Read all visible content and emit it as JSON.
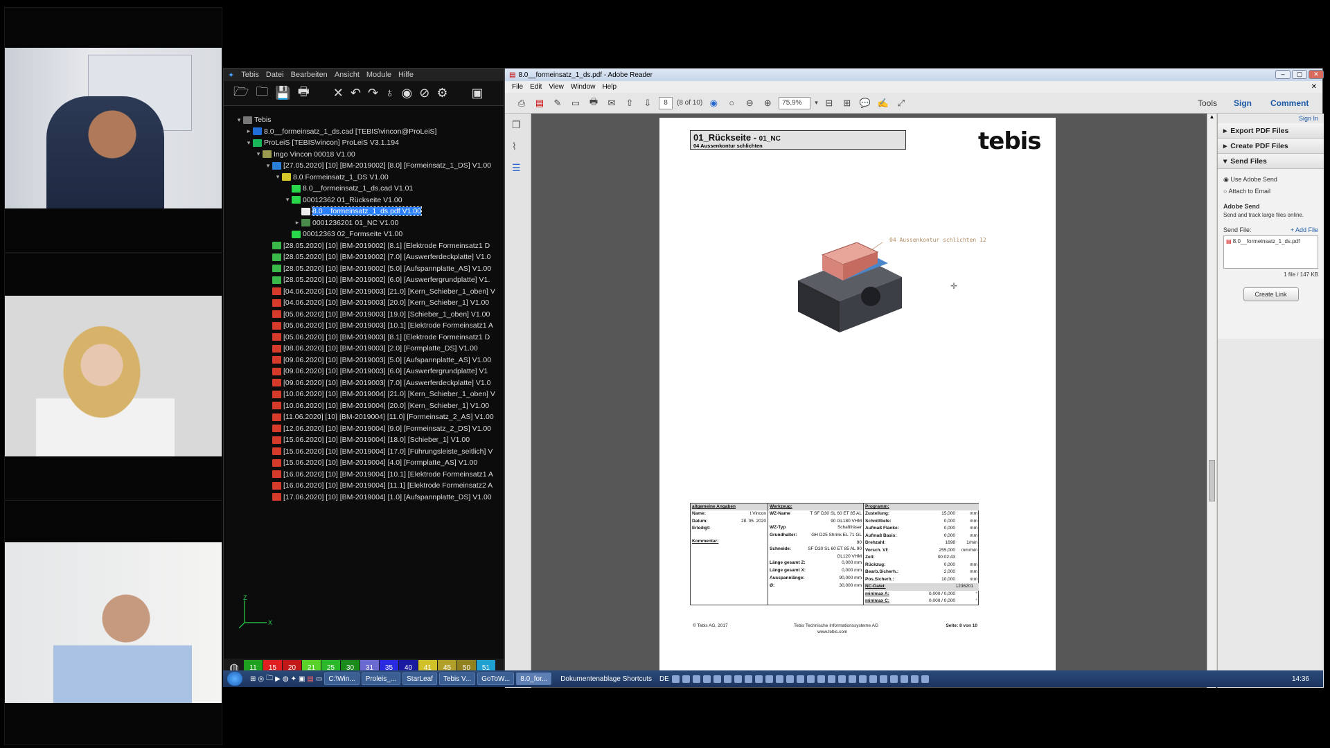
{
  "tebis": {
    "menu": [
      "Tebis",
      "Datei",
      "Bearbeiten",
      "Ansicht",
      "Module",
      "Hilfe"
    ],
    "tree": [
      {
        "label": "Tebis",
        "indent": 0,
        "twisty": "▾",
        "color": "#777"
      },
      {
        "label": "8.0__formeinsatz_1_ds.cad [TEBIS\\vincon@ProLeiS]",
        "indent": 1,
        "twisty": "▸",
        "color": "#1f6fd6"
      },
      {
        "label": "ProLeiS [TEBIS\\vincon] ProLeiS V3.1.194",
        "indent": 1,
        "twisty": "▾",
        "color": "#18b85a"
      },
      {
        "label": "Ingo Vincon 00018 V1.00",
        "indent": 2,
        "twisty": "▾",
        "color": "#9a9a50"
      },
      {
        "label": "[27.05.2020] [10] [BM-2019002] [8.0] [Formeinsatz_1_DS] V1.00",
        "indent": 3,
        "twisty": "▾",
        "color": "#2a7fd6"
      },
      {
        "label": "8.0 Formeinsatz_1_DS V1.00",
        "indent": 4,
        "twisty": "▾",
        "color": "#d6c82a"
      },
      {
        "label": "8.0__formeinsatz_1_ds.cad V1.01",
        "indent": 5,
        "twisty": "",
        "color": "#2ad64a"
      },
      {
        "label": "00012362 01_Rückseite V1.00",
        "indent": 5,
        "twisty": "▾",
        "color": "#2ad64a"
      },
      {
        "label": "8.0__formeinsatz_1_ds.pdf V1.00",
        "indent": 6,
        "twisty": "",
        "color": "#eeeeee",
        "selected": true
      },
      {
        "label": "0001236201 01_NC V1.00",
        "indent": 6,
        "twisty": "▸",
        "color": "#4a8a4a"
      },
      {
        "label": "00012363 02_Formseite V1.00",
        "indent": 5,
        "twisty": "",
        "color": "#2ad64a"
      },
      {
        "label": "[28.05.2020] [10] [BM-2019002] [8.1] [Elektrode Formeinsatz1 D",
        "indent": 3,
        "twisty": "",
        "color": "#3ab84a"
      },
      {
        "label": "[28.05.2020] [10] [BM-2019002] [7.0] [Auswerferdeckplatte] V1.0",
        "indent": 3,
        "twisty": "",
        "color": "#3ab84a"
      },
      {
        "label": "[28.05.2020] [10] [BM-2019002] [5.0] [Aufspannplatte_AS] V1.00",
        "indent": 3,
        "twisty": "",
        "color": "#3ab84a"
      },
      {
        "label": "[28.05.2020] [10] [BM-2019002] [6.0] [Auswerfergrundplatte] V1.",
        "indent": 3,
        "twisty": "",
        "color": "#3ab84a"
      },
      {
        "label": "[04.06.2020] [10] [BM-2019003] [21.0] [Kern_Schieber_1_oben] V",
        "indent": 3,
        "twisty": "",
        "color": "#d63a2a"
      },
      {
        "label": "[04.06.2020] [10] [BM-2019003] [20.0] [Kern_Schieber_1] V1.00",
        "indent": 3,
        "twisty": "",
        "color": "#d63a2a"
      },
      {
        "label": "[05.06.2020] [10] [BM-2019003] [19.0] [Schieber_1_oben] V1.00",
        "indent": 3,
        "twisty": "",
        "color": "#d63a2a"
      },
      {
        "label": "[05.06.2020] [10] [BM-2019003] [10.1] [Elektrode Formeinsatz1 A",
        "indent": 3,
        "twisty": "",
        "color": "#d63a2a"
      },
      {
        "label": "[05.06.2020] [10] [BM-2019003] [8.1] [Elektrode Formeinsatz1 D",
        "indent": 3,
        "twisty": "",
        "color": "#d63a2a"
      },
      {
        "label": "[08.06.2020] [10] [BM-2019003] [2.0] [Formplatte_DS] V1.00",
        "indent": 3,
        "twisty": "",
        "color": "#d63a2a"
      },
      {
        "label": "[09.06.2020] [10] [BM-2019003] [5.0] [Aufspannplatte_AS] V1.00",
        "indent": 3,
        "twisty": "",
        "color": "#d63a2a"
      },
      {
        "label": "[09.06.2020] [10] [BM-2019003] [6.0] [Auswerfergrundplatte] V1",
        "indent": 3,
        "twisty": "",
        "color": "#d63a2a"
      },
      {
        "label": "[09.06.2020] [10] [BM-2019003] [7.0] [Auswerferdeckplatte] V1.0",
        "indent": 3,
        "twisty": "",
        "color": "#d63a2a"
      },
      {
        "label": "[10.06.2020] [10] [BM-2019004] [21.0] [Kern_Schieber_1_oben] V",
        "indent": 3,
        "twisty": "",
        "color": "#d63a2a"
      },
      {
        "label": "[10.06.2020] [10] [BM-2019004] [20.0] [Kern_Schieber_1] V1.00",
        "indent": 3,
        "twisty": "",
        "color": "#d63a2a"
      },
      {
        "label": "[11.06.2020] [10] [BM-2019004] [11.0] [Formeinsatz_2_AS] V1.00",
        "indent": 3,
        "twisty": "",
        "color": "#d63a2a"
      },
      {
        "label": "[12.06.2020] [10] [BM-2019004] [9.0] [Formeinsatz_2_DS] V1.00",
        "indent": 3,
        "twisty": "",
        "color": "#d63a2a"
      },
      {
        "label": "[15.06.2020] [10] [BM-2019004] [18.0] [Schieber_1] V1.00",
        "indent": 3,
        "twisty": "",
        "color": "#d63a2a"
      },
      {
        "label": "[15.06.2020] [10] [BM-2019004] [17.0] [Führungsleiste_seitlich] V",
        "indent": 3,
        "twisty": "",
        "color": "#d63a2a"
      },
      {
        "label": "[15.06.2020] [10] [BM-2019004] [4.0] [Formplatte_AS] V1.00",
        "indent": 3,
        "twisty": "",
        "color": "#d63a2a"
      },
      {
        "label": "[16.06.2020] [10] [BM-2019004] [10.1] [Elektrode Formeinsatz1 A",
        "indent": 3,
        "twisty": "",
        "color": "#d63a2a"
      },
      {
        "label": "[16.06.2020] [10] [BM-2019004] [11.1] [Elektrode Formeinsatz2 A",
        "indent": 3,
        "twisty": "",
        "color": "#d63a2a"
      },
      {
        "label": "[17.06.2020] [10] [BM-2019004] [1.0] [Aufspannplatte_DS] V1.00",
        "indent": 3,
        "twisty": "",
        "color": "#d63a2a"
      }
    ],
    "colors": [
      {
        "label": "11",
        "bg": "#1fa01f"
      },
      {
        "label": "15",
        "bg": "#e02020"
      },
      {
        "label": "20",
        "bg": "#c01818"
      },
      {
        "label": "21",
        "bg": "#5ad02a"
      },
      {
        "label": "25",
        "bg": "#2ab82a"
      },
      {
        "label": "30",
        "bg": "#1a8a1a"
      },
      {
        "label": "31",
        "bg": "#6a6ad0"
      },
      {
        "label": "35",
        "bg": "#2a2ae0"
      },
      {
        "label": "40",
        "bg": "#1a1aa0"
      },
      {
        "label": "41",
        "bg": "#d0c02a"
      },
      {
        "label": "45",
        "bg": "#b0a02a"
      },
      {
        "label": "50",
        "bg": "#908020"
      },
      {
        "label": "51",
        "bg": "#20a0d0"
      }
    ]
  },
  "adobe": {
    "title": "8.0__formeinsatz_1_ds.pdf - Adobe Reader",
    "menu": [
      "File",
      "Edit",
      "View",
      "Window",
      "Help"
    ],
    "page_input": "8",
    "page_of": "(8 of 10)",
    "zoom": "75,9%",
    "tools": "Tools",
    "sign": "Sign",
    "comment": "Comment",
    "sign_in": "Sign In",
    "panel": {
      "export": "Export PDF Files",
      "create": "Create PDF Files",
      "send": "Send Files",
      "use_adobe_send": "Use Adobe Send",
      "attach_email": "Attach to Email",
      "adobe_send_title": "Adobe Send",
      "adobe_send_desc": "Send and track large files online.",
      "send_file": "Send File:",
      "add_file": "+ Add File",
      "file_name": "8.0__formeinsatz_1_ds.pdf",
      "file_info": "1 file / 147 KB",
      "create_link": "Create Link"
    }
  },
  "pdf": {
    "title_main": "01_Rückseite - ",
    "title_sub": "01_NC",
    "subtitle": "04 Aussenkontur schlichten",
    "logo": "tebis",
    "callout": "04 Aussenkontur schlichten 12",
    "allg": {
      "header": "allgemeine Angaben",
      "name_k": "Name:",
      "name_v": "I.Vincon",
      "datum_k": "Datum:",
      "datum_v": "28. 05. 2020",
      "erledigt_k": "Erledigt:",
      "kommentar": "Kommentar:"
    },
    "werkzeug": {
      "header": "Werkzeug:",
      "rows": [
        {
          "k": "WZ-Name",
          "v": "T SF D30 SL 60 ET 85 AL 90 GL180 VHM"
        },
        {
          "k": "WZ-Typ",
          "v": "Schaftfräser"
        },
        {
          "k": "Grundhalter:",
          "v": "GH D25 Shrink EL 71 GL 90"
        },
        {
          "k": "Schneide:",
          "v": "SF D30 SL 60 ET 85 AL 90 GL120 VHM"
        },
        {
          "k": "Länge gesamt Z:",
          "v": "0,000 mm"
        },
        {
          "k": "Länge gesamt X:",
          "v": "0,000 mm"
        },
        {
          "k": "Ausspannlänge:",
          "v": "90,000 mm"
        },
        {
          "k": "Ø:",
          "v": "30,000 mm"
        }
      ]
    },
    "programm": {
      "header": "Programm:",
      "rows": [
        {
          "k": "Zustellung:",
          "v": "15,000",
          "u": "mm"
        },
        {
          "k": "Schnitttiefe:",
          "v": "0,000",
          "u": "mm"
        },
        {
          "k": "Aufmaß Flanke:",
          "v": "0,000",
          "u": "mm"
        },
        {
          "k": "Aufmaß Basis:",
          "v": "0,000",
          "u": "mm"
        },
        {
          "k": "Drehzahl:",
          "v": "1698",
          "u": "1/min"
        },
        {
          "k": "Vorsch. Vf:",
          "v": "255,000",
          "u": "mm/min"
        },
        {
          "k": "Zeit:",
          "v": "00:02:43",
          "u": ""
        },
        {
          "k": "Rückzug:",
          "v": "0,000",
          "u": "mm"
        },
        {
          "k": "Bearb.Sicherh.:",
          "v": "2,000",
          "u": "mm"
        },
        {
          "k": "Pos.Sicherh.:",
          "v": "10,000",
          "u": "mm"
        }
      ],
      "nc_k": "NC-Datei:",
      "nc_v": "1236201",
      "minmaxA_k": "min/max A:",
      "minmaxA_v": "0,000 / 0,000",
      "minmaxC_k": "min/max C:",
      "minmaxC_v": "0,000 / 0,000",
      "deg": "°"
    },
    "footer_left": "© Tebis AG, 2017",
    "footer_center": "Tebis Technische Informationssysteme AG",
    "footer_center2": "www.tebis.com",
    "footer_right": "Seite: 8 von 10"
  },
  "taskbar": {
    "items": [
      "C:\\Win...",
      "Proleis_...",
      "StarLeaf",
      "Tebis V...",
      "GoToW...",
      "8.0_for..."
    ],
    "quicklaunch": "Dokumentenablage Shortcuts",
    "lang": "DE",
    "clock": "14:36"
  }
}
